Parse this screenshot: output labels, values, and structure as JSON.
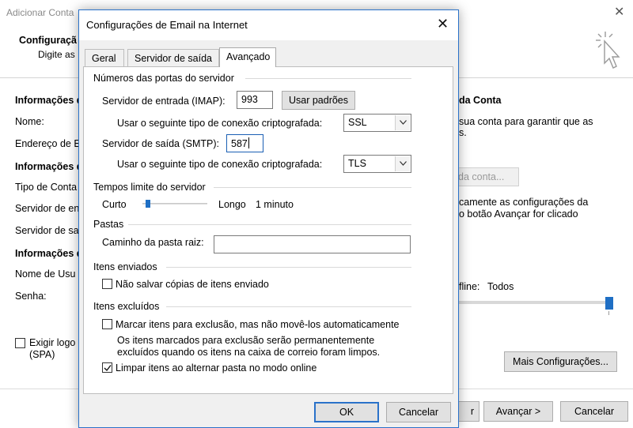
{
  "background": {
    "window_title": "Adicionar Conta",
    "header_title": "Configuraçã",
    "header_subtitle": "Digite as",
    "section_user": "Informações d",
    "name_label": "Nome:",
    "email_label": "Endereço de E",
    "section_server": "Informações d",
    "account_type_label": "Tipo de Conta",
    "incoming_label": "Servidor de en",
    "outgoing_label": "Servidor de sa",
    "section_logon": "Informações d",
    "username_label": "Nome de Usu",
    "password_label": "Senha:",
    "spa_line1": "Exigir logo",
    "spa_line2": "(SPA)",
    "right_title": "da Conta",
    "right_text1": "sua conta para garantir que as",
    "right_text2": "s.",
    "test_button": "da conta...",
    "right_text3": "camente as configurações da",
    "right_text4": "o botão Avançar for clicado",
    "offline_label": "fline:",
    "offline_value": "Todos",
    "more_settings_button": "Mais Configurações...",
    "back_button": "r",
    "next_button": "Avançar >",
    "cancel_button": "Cancelar"
  },
  "dialog": {
    "title": "Configurações de Email na Internet",
    "tabs": [
      {
        "label": "Geral",
        "active": false
      },
      {
        "label": "Servidor de saída",
        "active": false
      },
      {
        "label": "Avançado",
        "active": true
      }
    ],
    "ports": {
      "heading": "Números das portas do servidor",
      "incoming_label": "Servidor de entrada (IMAP):",
      "incoming_value": "993",
      "defaults_button": "Usar padrões",
      "incoming_enc_label": "Usar o seguinte tipo de conexão criptografada:",
      "incoming_enc_value": "SSL",
      "outgoing_label": "Servidor de saída (SMTP):",
      "outgoing_value": "587",
      "outgoing_enc_label": "Usar o seguinte tipo de conexão criptografada:",
      "outgoing_enc_value": "TLS"
    },
    "timeouts": {
      "heading": "Tempos limite do servidor",
      "short_label": "Curto",
      "long_label": "Longo",
      "value": "1 minuto",
      "slider_fraction": 0.05
    },
    "folders": {
      "heading": "Pastas",
      "root_label": "Caminho da pasta raiz:",
      "root_value": ""
    },
    "sent": {
      "heading": "Itens enviados",
      "dont_save_label": "Não salvar cópias de itens enviado",
      "dont_save_checked": false
    },
    "deleted": {
      "heading": "Itens excluídos",
      "mark_label": "Marcar itens para exclusão, mas não movê-los automaticamente",
      "mark_checked": false,
      "note_line1": "Os itens marcados para exclusão serão permanentemente",
      "note_line2": "excluídos quando os itens na caixa de correio foram limpos.",
      "purge_label": "Limpar itens ao alternar pasta no modo online",
      "purge_checked": true
    },
    "ok_button": "OK",
    "cancel_button": "Cancelar"
  },
  "colors": {
    "accent": "#1f6fc4",
    "dialog_border": "#2a72c9",
    "button_bg": "#e1e1e1"
  }
}
